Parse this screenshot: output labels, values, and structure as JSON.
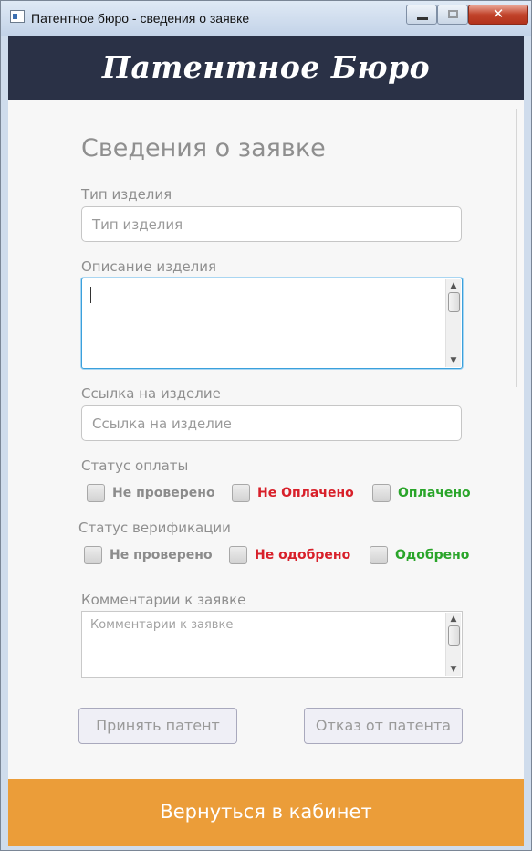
{
  "window": {
    "title": "Патентное бюро - сведения о заявке",
    "close_glyph": "✕"
  },
  "header": {
    "title": "Патентное Бюро"
  },
  "form": {
    "heading": "Сведения о заявке",
    "product_type": {
      "label": "Тип изделия",
      "placeholder": "Тип изделия"
    },
    "product_description": {
      "label": "Описание изделия",
      "value": ""
    },
    "product_link": {
      "label": "Ссылка на изделие",
      "placeholder": "Ссылка на изделие"
    },
    "payment_status": {
      "label": "Статус оплаты",
      "options": [
        {
          "label": "Не проверено",
          "color": "#8c8c8c",
          "checked": false
        },
        {
          "label": "Не Оплачено",
          "color": "#d8202a",
          "checked": false
        },
        {
          "label": "Оплачено",
          "color": "#2aa52a",
          "checked": false
        }
      ]
    },
    "verification_status": {
      "label": "Статус верификации",
      "options": [
        {
          "label": "Не проверено",
          "color": "#8c8c8c",
          "checked": false
        },
        {
          "label": "Не одобрено",
          "color": "#d8202a",
          "checked": false
        },
        {
          "label": "Одобрено",
          "color": "#2aa52a",
          "checked": false
        }
      ]
    },
    "comments": {
      "label": "Комментарии к заявке",
      "placeholder": "Комментарии к заявке"
    }
  },
  "actions": {
    "accept_label": "Принять патент",
    "reject_label": "Отказ от патента"
  },
  "footer": {
    "back_label": "Вернуться в кабинет"
  },
  "colors": {
    "header_bg": "#2a3146",
    "footer_bg": "#eb9d39",
    "focus_border": "#3aa0dc"
  }
}
